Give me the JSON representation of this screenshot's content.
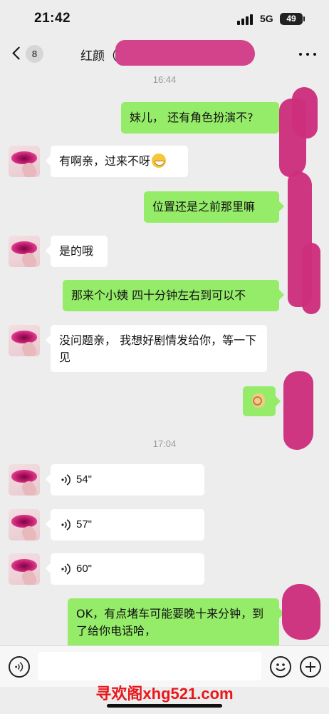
{
  "status_bar": {
    "time": "21:42",
    "network": "5G",
    "battery": "49"
  },
  "nav": {
    "unread_count": "8",
    "title": "红颜（",
    "back_icon": "chevron-left-icon",
    "more_icon": "more-dots-icon"
  },
  "messages": {
    "time_1": "16:44",
    "m1": "妹儿， 还有角色扮演不?",
    "m2": "有啊亲，过来不呀",
    "m3": "位置还是之前那里嘛",
    "m4": "是的哦",
    "m5": "那来个小姨 四十分钟左右到可以不",
    "m6": "没问题亲， 我想好剧情发给你，等一下见",
    "m7_icon": "ok-hand-icon",
    "time_2": "17:04",
    "v1": "54\"",
    "v2": "57\"",
    "v3": "60\"",
    "m8": "OK，有点堵车可能要晚十来分钟，到了给你电话哈，"
  },
  "input_bar": {
    "voice_icon": "voice-toggle-icon",
    "emoji_icon": "emoji-icon",
    "add_icon": "plus-icon"
  },
  "watermark": "寻欢阁xhg521.com",
  "colors": {
    "background": "#ededed",
    "outgoing_bubble": "#95ec69",
    "incoming_bubble": "#ffffff",
    "redaction": "#cc2f7d",
    "watermark": "#e8171b"
  }
}
